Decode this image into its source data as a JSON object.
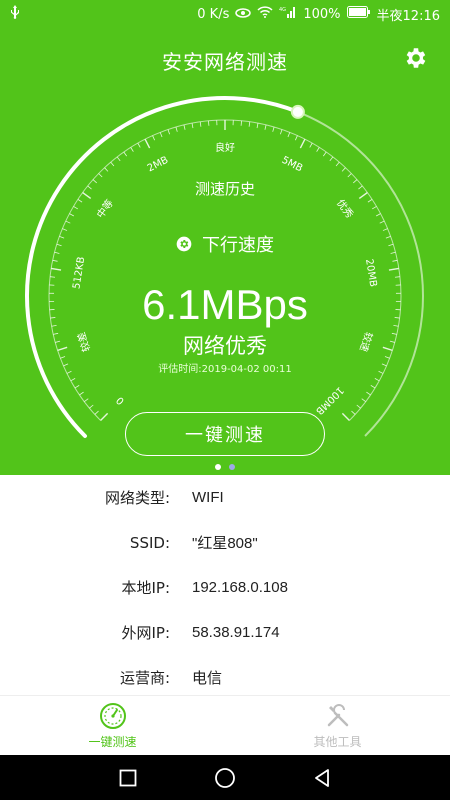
{
  "status_bar": {
    "net_speed": "0 K/s",
    "signal_label": "4G",
    "battery": "100%",
    "time": "半夜12:16"
  },
  "header": {
    "title": "安安网络测速",
    "settings_icon": "gear-icon"
  },
  "gauge": {
    "scale_labels": [
      "0",
      "较差",
      "512KB",
      "中等",
      "2MB",
      "良好",
      "5MB",
      "优秀",
      "20MB",
      "较速",
      "100MB"
    ],
    "progress_fraction": 0.58,
    "colors": {
      "track": "#ffffff",
      "bg": "#52c41a"
    }
  },
  "main": {
    "history_label": "测速历史",
    "direction_label": "下行速度",
    "direction_icon": "gear-icon",
    "speed": "6.1MBps",
    "rating": "网络优秀",
    "eval_time": "评估时间:2019-04-02 00:11",
    "test_button": "一键测速"
  },
  "info": [
    {
      "label": "网络类型:",
      "value": "WIFI"
    },
    {
      "label": "SSID:",
      "value": "\"红星808\""
    },
    {
      "label": "本地IP:",
      "value": "192.168.0.108"
    },
    {
      "label": "外网IP:",
      "value": "58.38.91.174"
    },
    {
      "label": "运营商:",
      "value": "电信"
    }
  ],
  "tabs": [
    {
      "label": "一键测速",
      "icon": "speedometer-icon",
      "active": true
    },
    {
      "label": "其他工具",
      "icon": "tools-icon",
      "active": false
    }
  ],
  "colors": {
    "accent": "#52c41a",
    "inactive": "#bdbdbd"
  }
}
